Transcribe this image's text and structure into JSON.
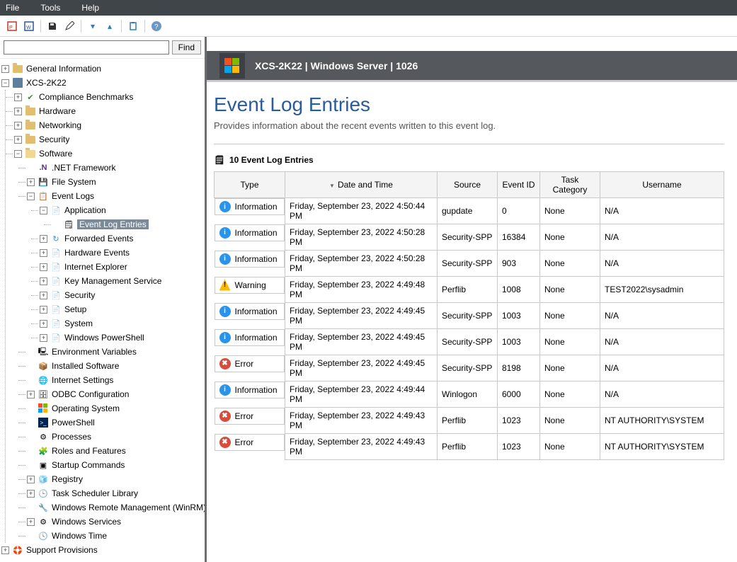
{
  "menubar": {
    "file": "File",
    "tools": "Tools",
    "help": "Help"
  },
  "search": {
    "placeholder": "",
    "button": "Find"
  },
  "tree": {
    "general_information": "General Information",
    "server": "XCS-2K22",
    "compliance": "Compliance Benchmarks",
    "hardware": "Hardware",
    "networking": "Networking",
    "security": "Security",
    "software": "Software",
    "net_framework": ".NET Framework",
    "file_system": "File System",
    "event_logs": "Event Logs",
    "application": "Application",
    "event_log_entries": "Event Log Entries",
    "forwarded_events": "Forwarded Events",
    "hardware_events": "Hardware Events",
    "internet_explorer": "Internet Explorer",
    "key_mgmt": "Key Management Service",
    "evsecurity": "Security",
    "setup": "Setup",
    "system": "System",
    "powershell": "Windows PowerShell",
    "env_vars": "Environment Variables",
    "installed_sw": "Installed Software",
    "internet_settings": "Internet Settings",
    "odbc": "ODBC Configuration",
    "os": "Operating System",
    "ps": "PowerShell",
    "processes": "Processes",
    "roles": "Roles and Features",
    "startup": "Startup Commands",
    "registry": "Registry",
    "task_sched": "Task Scheduler Library",
    "winrm": "Windows Remote Management (WinRM)",
    "win_services": "Windows Services",
    "win_time": "Windows Time",
    "support": "Support Provisions"
  },
  "header": {
    "title": "XCS-2K22 | Windows Server | 1026"
  },
  "page": {
    "title": "Event Log Entries",
    "subtitle": "Provides information about the recent events written to this event log.",
    "count_label": "10 Event Log Entries"
  },
  "table": {
    "headers": {
      "type": "Type",
      "datetime": "Date and Time",
      "source": "Source",
      "event_id": "Event ID",
      "task_category": "Task Category",
      "username": "Username"
    },
    "rows": [
      {
        "type": "Information",
        "icon": "info",
        "datetime": "Friday, September 23, 2022 4:50:44 PM",
        "source": "gupdate",
        "event_id": "0",
        "task_category": "None",
        "username": "N/A"
      },
      {
        "type": "Information",
        "icon": "info",
        "datetime": "Friday, September 23, 2022 4:50:28 PM",
        "source": "Security-SPP",
        "event_id": "16384",
        "task_category": "None",
        "username": "N/A"
      },
      {
        "type": "Information",
        "icon": "info",
        "datetime": "Friday, September 23, 2022 4:50:28 PM",
        "source": "Security-SPP",
        "event_id": "903",
        "task_category": "None",
        "username": "N/A"
      },
      {
        "type": "Warning",
        "icon": "warn",
        "datetime": "Friday, September 23, 2022 4:49:48 PM",
        "source": "Perflib",
        "event_id": "1008",
        "task_category": "None",
        "username": "TEST2022\\sysadmin"
      },
      {
        "type": "Information",
        "icon": "info",
        "datetime": "Friday, September 23, 2022 4:49:45 PM",
        "source": "Security-SPP",
        "event_id": "1003",
        "task_category": "None",
        "username": "N/A"
      },
      {
        "type": "Information",
        "icon": "info",
        "datetime": "Friday, September 23, 2022 4:49:45 PM",
        "source": "Security-SPP",
        "event_id": "1003",
        "task_category": "None",
        "username": "N/A"
      },
      {
        "type": "Error",
        "icon": "err",
        "datetime": "Friday, September 23, 2022 4:49:45 PM",
        "source": "Security-SPP",
        "event_id": "8198",
        "task_category": "None",
        "username": "N/A"
      },
      {
        "type": "Information",
        "icon": "info",
        "datetime": "Friday, September 23, 2022 4:49:44 PM",
        "source": "Winlogon",
        "event_id": "6000",
        "task_category": "None",
        "username": "N/A"
      },
      {
        "type": "Error",
        "icon": "err",
        "datetime": "Friday, September 23, 2022 4:49:43 PM",
        "source": "Perflib",
        "event_id": "1023",
        "task_category": "None",
        "username": "NT AUTHORITY\\SYSTEM"
      },
      {
        "type": "Error",
        "icon": "err",
        "datetime": "Friday, September 23, 2022 4:49:43 PM",
        "source": "Perflib",
        "event_id": "1023",
        "task_category": "None",
        "username": "NT AUTHORITY\\SYSTEM"
      }
    ]
  }
}
